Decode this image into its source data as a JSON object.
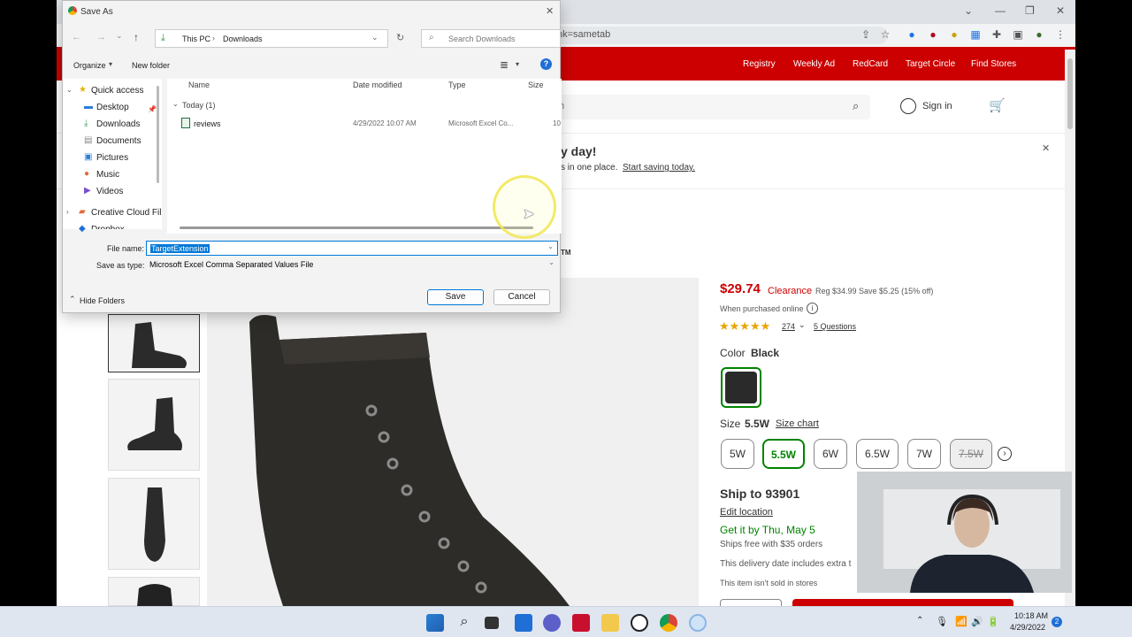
{
  "browser": {
    "url_fragment": "nk=sametab"
  },
  "target": {
    "nav_links": [
      "Registry",
      "Weekly Ad",
      "RedCard",
      "Target Circle",
      "Find Stores"
    ],
    "search_placeholder_fragment": "h",
    "sign_in": "Sign in",
    "banner_title_fragment": "y day!",
    "banner_text_fragment": "s in one place.",
    "banner_link": "Start saving today.",
    "tm_fragment": "TM",
    "price": "$29.74",
    "clearance": "Clearance",
    "reg_price": "Reg $34.99 Save $5.25 (15% off)",
    "when_purchased": "When purchased online",
    "rating_count": "274",
    "questions": "5 Questions",
    "color_label": "Color",
    "color_value": "Black",
    "size_label": "Size",
    "size_value": "5.5W",
    "size_chart": "Size chart",
    "sizes": [
      "5W",
      "5.5W",
      "6W",
      "6.5W",
      "7W",
      "7.5W"
    ],
    "ship_to": "Ship to 93901",
    "edit_location": "Edit location",
    "get_it_by": "Get it by Thu, May 5",
    "ships_free": "Ships free with $35 orders",
    "delivery_note": "This delivery date includes extra t",
    "not_sold": "This item isn't sold in stores"
  },
  "dialog": {
    "title": "Save As",
    "breadcrumb": [
      "This PC",
      "Downloads"
    ],
    "search_placeholder": "Search Downloads",
    "organize": "Organize",
    "new_folder": "New folder",
    "nav_items": [
      "Quick access",
      "Desktop",
      "Downloads",
      "Documents",
      "Pictures",
      "Music",
      "Videos",
      "Creative Cloud Fil",
      "Dropbox"
    ],
    "columns": [
      "Name",
      "Date modified",
      "Type",
      "Size"
    ],
    "group_label": "Today (1)",
    "file": {
      "name": "reviews",
      "date": "4/29/2022 10:07 AM",
      "type": "Microsoft Excel Co...",
      "size": "10"
    },
    "file_name_label": "File name:",
    "file_name_value": "TargetExtension",
    "save_type_label": "Save as type:",
    "save_type_value": "Microsoft Excel Comma Separated Values File",
    "hide_folders": "Hide Folders",
    "save": "Save",
    "cancel": "Cancel"
  },
  "taskbar": {
    "time": "10:18 AM",
    "date": "4/29/2022",
    "notification_count": "2"
  },
  "colors": {
    "target_red": "#cc0000",
    "accent_green": "#008300",
    "selection_blue": "#0078d7"
  }
}
